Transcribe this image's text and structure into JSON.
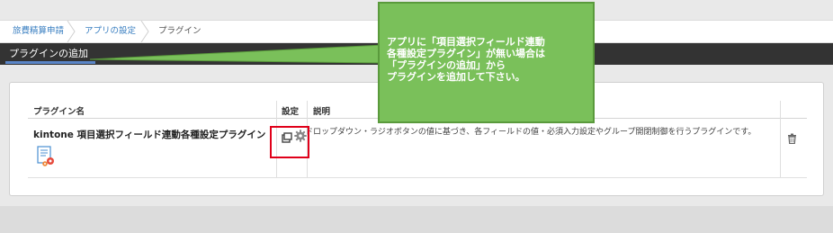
{
  "breadcrumb": {
    "items": [
      {
        "label": "旅費精算申請"
      },
      {
        "label": "アプリの設定"
      },
      {
        "label": "プラグイン"
      }
    ]
  },
  "header": {
    "title": "プラグインの追加"
  },
  "table": {
    "headers": {
      "name": "プラグイン名",
      "settings": "設定",
      "description": "説明"
    },
    "rows": [
      {
        "name": "kintone 項目選択フィールド連動各種設定プラグイン",
        "description": "ドロップダウン・ラジオボタンの値に基づき、各フィールドの値・必須入力設定やグループ開閉制御を行うプラグインです。"
      }
    ]
  },
  "callout": {
    "text": "アプリに「項目選択フィールド連動\n各種設定プラグイン」が無い場合は\n「プラグインの追加」から\nプラグインを追加して下さい。"
  },
  "colors": {
    "accent_red": "#e0001a",
    "callout_green": "#7ac05a",
    "header_dark": "#333333",
    "link_blue": "#3a7fc1"
  },
  "icons": [
    "settings-gear-icon",
    "popup-window-icon",
    "trash-icon",
    "plugin-logo-icon",
    "chevron-right-icon"
  ]
}
